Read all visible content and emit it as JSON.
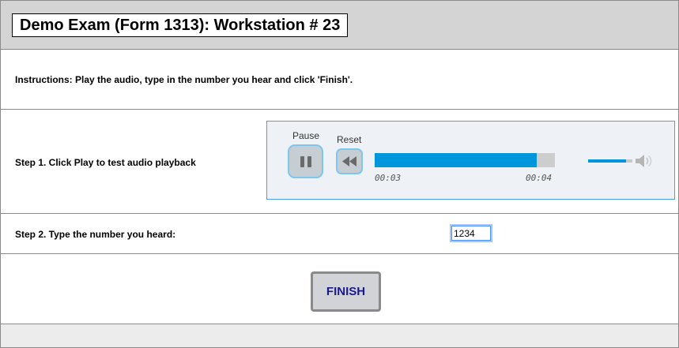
{
  "header": {
    "title": "Demo Exam (Form 1313): Workstation # 23"
  },
  "instructions": "Instructions: Play the audio, type in the number you hear and click 'Finish'.",
  "step1": {
    "label": "Step 1. Click Play to test audio playback",
    "player": {
      "pause_label": "Pause",
      "reset_label": "Reset",
      "current_time": "00:03",
      "duration": "00:04",
      "progress_fraction": 0.9,
      "volume_fraction": 0.85,
      "icons": [
        "pause-icon",
        "rewind-icon",
        "speaker-icon"
      ],
      "accent_color": "#0096dc"
    }
  },
  "step2": {
    "label": "Step 2. Type the number you heard:",
    "answer_value": "1234"
  },
  "finish": {
    "label": "FINISH"
  }
}
